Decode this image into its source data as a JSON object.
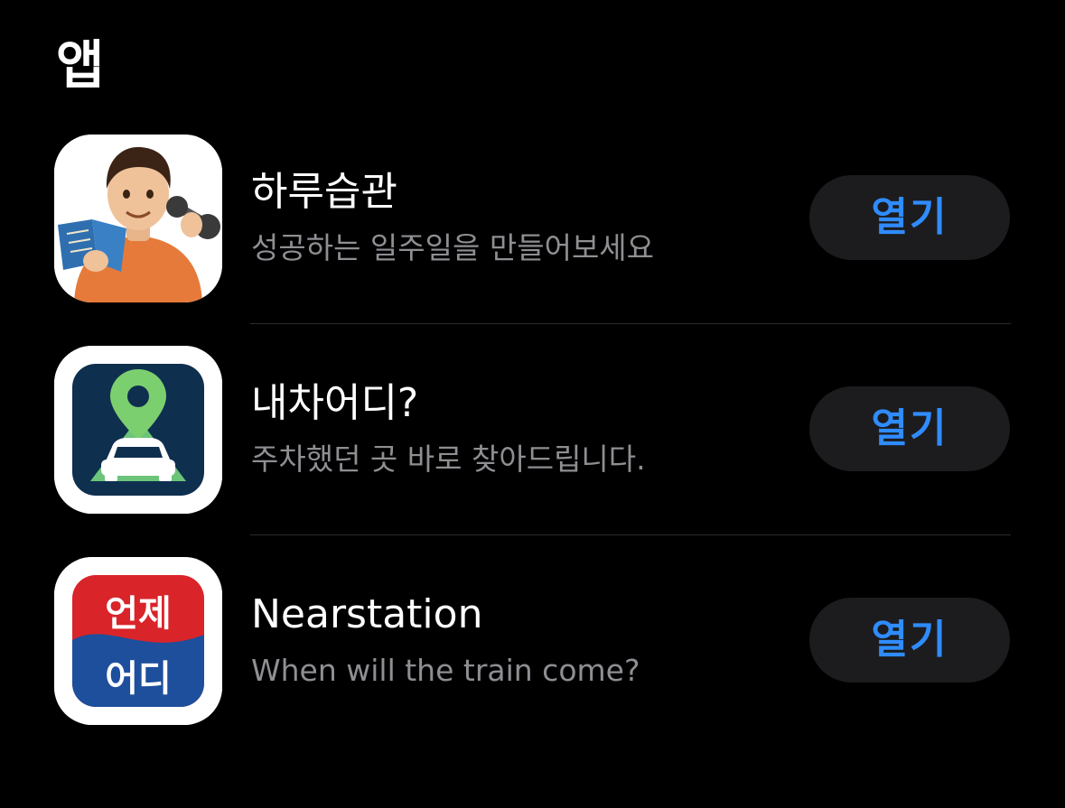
{
  "section": {
    "title": "앱"
  },
  "apps": [
    {
      "icon": "habit-app-icon",
      "name": "하루습관",
      "description": "성공하는 일주일을 만들어보세요",
      "button_label": "열기"
    },
    {
      "icon": "car-location-app-icon",
      "name": "내차어디?",
      "description": "주차했던 곳 바로 찾아드립니다.",
      "button_label": "열기"
    },
    {
      "icon": "subway-app-icon",
      "name": "Nearstation",
      "description": "When will the train come?",
      "button_label": "열기",
      "icon_text_top": "언제",
      "icon_text_bottom": "어디"
    }
  ],
  "colors": {
    "background": "#000000",
    "button_bg": "#1c1c1e",
    "button_text": "#2f8cff",
    "secondary_text": "#8e8e93"
  }
}
